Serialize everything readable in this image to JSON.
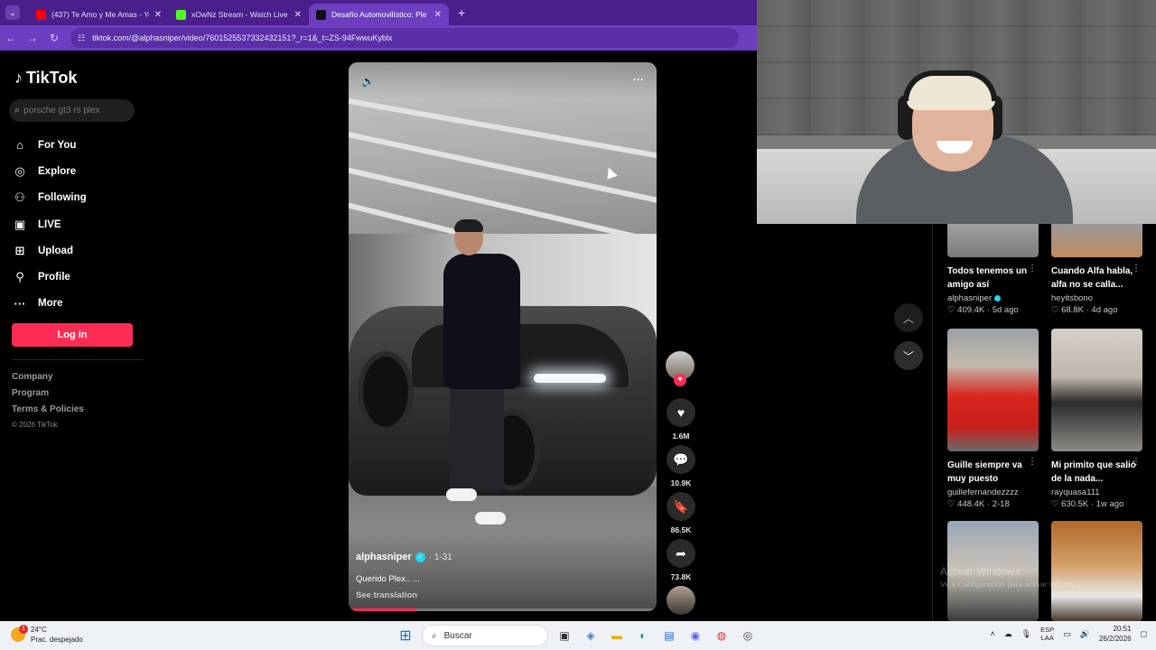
{
  "browser": {
    "tabs": [
      {
        "title": "(437) Te Amo y Me Amas - YouT",
        "favicon_color": "#ff0000"
      },
      {
        "title": "xOwNz Stream - Watch Live on",
        "favicon_color": "#53fc18"
      },
      {
        "title": "Desafío Automovilístico: Ple",
        "favicon_color": "#111111",
        "active": true
      }
    ],
    "url": "tiktok.com/@alphasniper/video/7601525537332432151?_r=1&_t=ZS-94FwwuKyblx"
  },
  "tiktok": {
    "logo_text": "TikTok",
    "search_placeholder": "porsche gt3 rs plex",
    "menu": [
      {
        "label": "For You",
        "icon": "home-icon",
        "glyph": "⌂"
      },
      {
        "label": "Explore",
        "icon": "compass-icon",
        "glyph": "◎"
      },
      {
        "label": "Following",
        "icon": "following-icon",
        "glyph": "⚇"
      },
      {
        "label": "LIVE",
        "icon": "live-icon",
        "glyph": "▣"
      },
      {
        "label": "Upload",
        "icon": "upload-icon",
        "glyph": "⊞"
      },
      {
        "label": "Profile",
        "icon": "profile-icon",
        "glyph": "⚲"
      },
      {
        "label": "More",
        "icon": "more-icon",
        "glyph": "···"
      }
    ],
    "login_label": "Log in",
    "footer_links": [
      "Company",
      "Program",
      "Terms & Policies"
    ],
    "copyright": "© 2026 TikTok"
  },
  "video": {
    "author": "alphasniper",
    "date": "· 1-31",
    "caption": "Querido Plex.. ...",
    "see_translation": "See translation",
    "progress": 0.22,
    "likes": "1.6M",
    "comments": "10.9K",
    "saves": "86.5K",
    "shares": "73.8K",
    "accent_color": "#fe2c55"
  },
  "related": [
    {
      "title": "Todos tenemos un amigo así",
      "user": "alphasniper",
      "verified": true,
      "meta": "♡ 409.4K · 5d ago"
    },
    {
      "title": "Cuando Alfa habla, alfa no se calla...",
      "user": "heyitsbono",
      "verified": false,
      "meta": "♡ 68.8K · 4d ago"
    },
    {
      "title": "Guille siempre va muy puesto",
      "user": "guillefernandezzzz",
      "verified": false,
      "meta": "♡ 448.4K · 2-18"
    },
    {
      "title": "Mi primito que salió de la nada...",
      "user": "rayquasa111",
      "verified": false,
      "meta": "♡ 630.5K · 1w ago"
    }
  ],
  "watermark": {
    "title": "Activar Windows",
    "subtitle": "Ve a Configuración para activar Windows."
  },
  "taskbar": {
    "temperature": "24°C",
    "weather": "Prac. despejado",
    "weather_badge": "1",
    "search_label": "Buscar",
    "lang_top": "ESP",
    "lang_bottom": "LAA",
    "time": "20:51",
    "date": "26/2/2026"
  }
}
